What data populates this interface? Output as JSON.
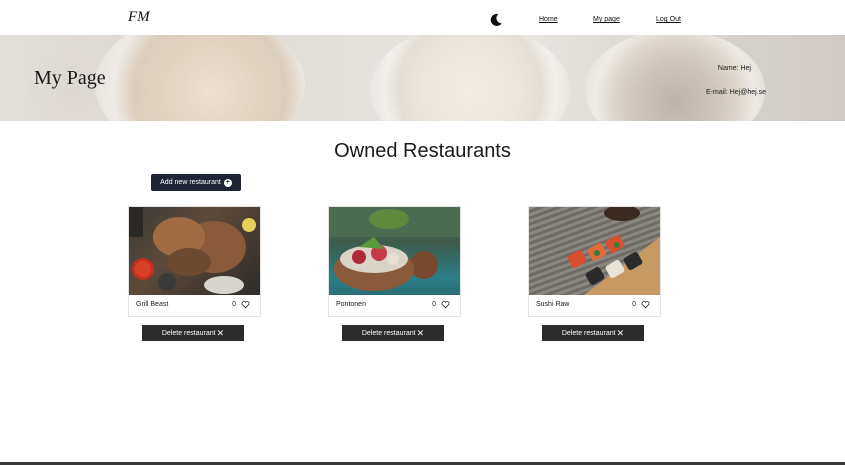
{
  "nav": {
    "logo": "FM",
    "theme_icon": "moon-icon",
    "links": [
      {
        "label": "Home"
      },
      {
        "label": "My page"
      },
      {
        "label": "Log Out"
      }
    ]
  },
  "banner": {
    "title": "My Page",
    "name_label": "Name: Hej",
    "email_label": "E-mail: Hej@hej.se"
  },
  "section": {
    "title": "Owned Restaurants",
    "add_button_label": "Add new restaurant",
    "add_icon": "plus-circle-icon"
  },
  "restaurants": [
    {
      "name": "Grill Beast",
      "likes": "0",
      "delete_label": "Delete restaurant"
    },
    {
      "name": "Pontonen",
      "likes": "0",
      "delete_label": "Delete restaurant"
    },
    {
      "name": "Sushi Raw",
      "likes": "0",
      "delete_label": "Delete restaurant"
    }
  ],
  "colors": {
    "primary_button": "#1d2433",
    "delete_button": "#2b2b2b"
  }
}
